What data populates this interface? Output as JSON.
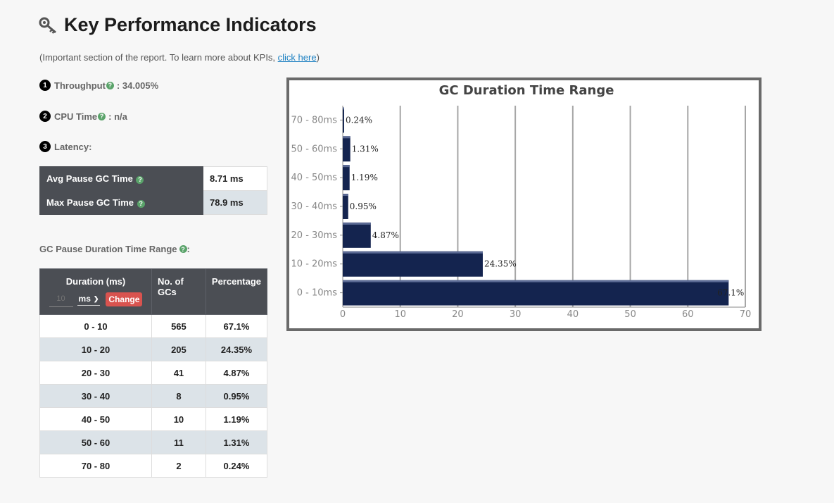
{
  "header": {
    "title": "Key Performance Indicators",
    "subtitle_prefix": "(Important section of the report. To learn more about KPIs, ",
    "subtitle_link": "click here",
    "subtitle_suffix": ")"
  },
  "kpis": [
    {
      "num": "1",
      "label": "Throughput",
      "value": ": 34.005%"
    },
    {
      "num": "2",
      "label": "CPU Time",
      "value": ": n/a"
    },
    {
      "num": "3",
      "label": "Latency:",
      "value": ""
    }
  ],
  "pause_table": [
    {
      "label": "Avg Pause GC Time",
      "value": "8.71 ms"
    },
    {
      "label": "Max Pause GC Time",
      "value": "78.9 ms"
    }
  ],
  "range_label": "GC Pause Duration Time Range",
  "gc_table": {
    "headers": {
      "duration": "Duration (ms)",
      "count": "No. of GCs",
      "percentage": "Percentage"
    },
    "interval_placeholder": "10",
    "unit": "ms",
    "change_label": "Change",
    "rows": [
      {
        "range": "0 - 10",
        "count": "565",
        "pct": "67.1%"
      },
      {
        "range": "10 - 20",
        "count": "205",
        "pct": "24.35%"
      },
      {
        "range": "20 - 30",
        "count": "41",
        "pct": "4.87%"
      },
      {
        "range": "30 - 40",
        "count": "8",
        "pct": "0.95%"
      },
      {
        "range": "40 - 50",
        "count": "10",
        "pct": "1.19%"
      },
      {
        "range": "50 - 60",
        "count": "11",
        "pct": "1.31%"
      },
      {
        "range": "70 - 80",
        "count": "2",
        "pct": "0.24%"
      }
    ]
  },
  "colors": {
    "bar": "#14244f",
    "header_bg": "#4b4e54",
    "stripe": "#dce3e8",
    "change_btn": "#d9534f",
    "help": "#5aa36a"
  },
  "chart_data": {
    "type": "bar",
    "orientation": "horizontal",
    "title": "GC Duration Time Range",
    "categories": [
      "0 - 10ms",
      "10 - 20ms",
      "20 - 30ms",
      "30 - 40ms",
      "40 - 50ms",
      "50 - 60ms",
      "70 - 80ms"
    ],
    "values": [
      67.1,
      24.35,
      4.87,
      0.95,
      1.19,
      1.31,
      0.24
    ],
    "labels": [
      "67.1%",
      "24.35%",
      "4.87%",
      "0.95%",
      "1.19%",
      "1.31%",
      "0.24%"
    ],
    "xlim": [
      0,
      70
    ],
    "xticks": [
      0,
      10,
      20,
      30,
      40,
      50,
      60,
      70
    ],
    "grid": true
  }
}
